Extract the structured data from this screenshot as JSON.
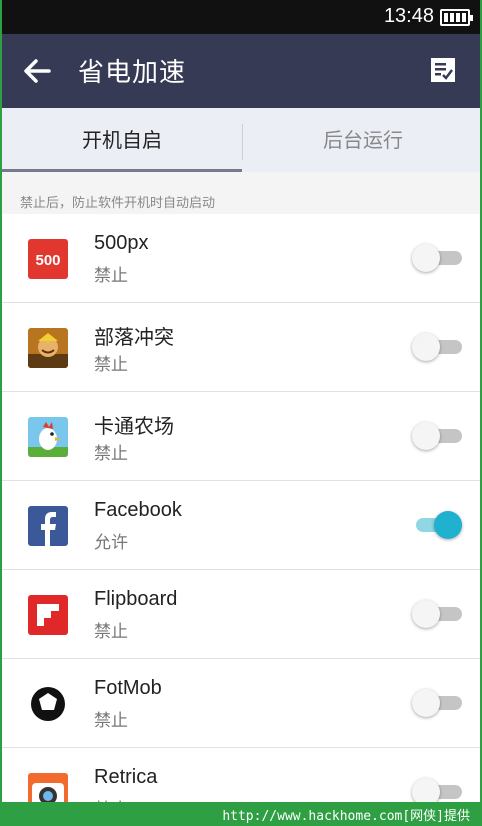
{
  "status_bar": {
    "time": "13:48"
  },
  "header": {
    "title": "省电加速"
  },
  "tabs": [
    {
      "label": "开机自启",
      "active": true
    },
    {
      "label": "后台运行",
      "active": false
    }
  ],
  "hint": "禁止后，防止软件开机时自动启动",
  "apps": [
    {
      "name": "500px",
      "status": "禁止",
      "enabled": false,
      "icon": "500px-icon"
    },
    {
      "name": "部落冲突",
      "status": "禁止",
      "enabled": false,
      "icon": "clash-of-clans-icon"
    },
    {
      "name": "卡通农场",
      "status": "禁止",
      "enabled": false,
      "icon": "hay-day-icon"
    },
    {
      "name": "Facebook",
      "status": "允许",
      "enabled": true,
      "icon": "facebook-icon"
    },
    {
      "name": "Flipboard",
      "status": "禁止",
      "enabled": false,
      "icon": "flipboard-icon"
    },
    {
      "name": "FotMob",
      "status": "禁止",
      "enabled": false,
      "icon": "fotmob-icon"
    },
    {
      "name": "Retrica",
      "status": "禁止",
      "enabled": false,
      "icon": "retrica-icon"
    }
  ],
  "footer": {
    "text": "http://www.hackhome.com[网侠]提供"
  },
  "colors": {
    "appbar": "#363a55",
    "toggle_on": "#1fb1cf",
    "footer": "#2ea043"
  }
}
